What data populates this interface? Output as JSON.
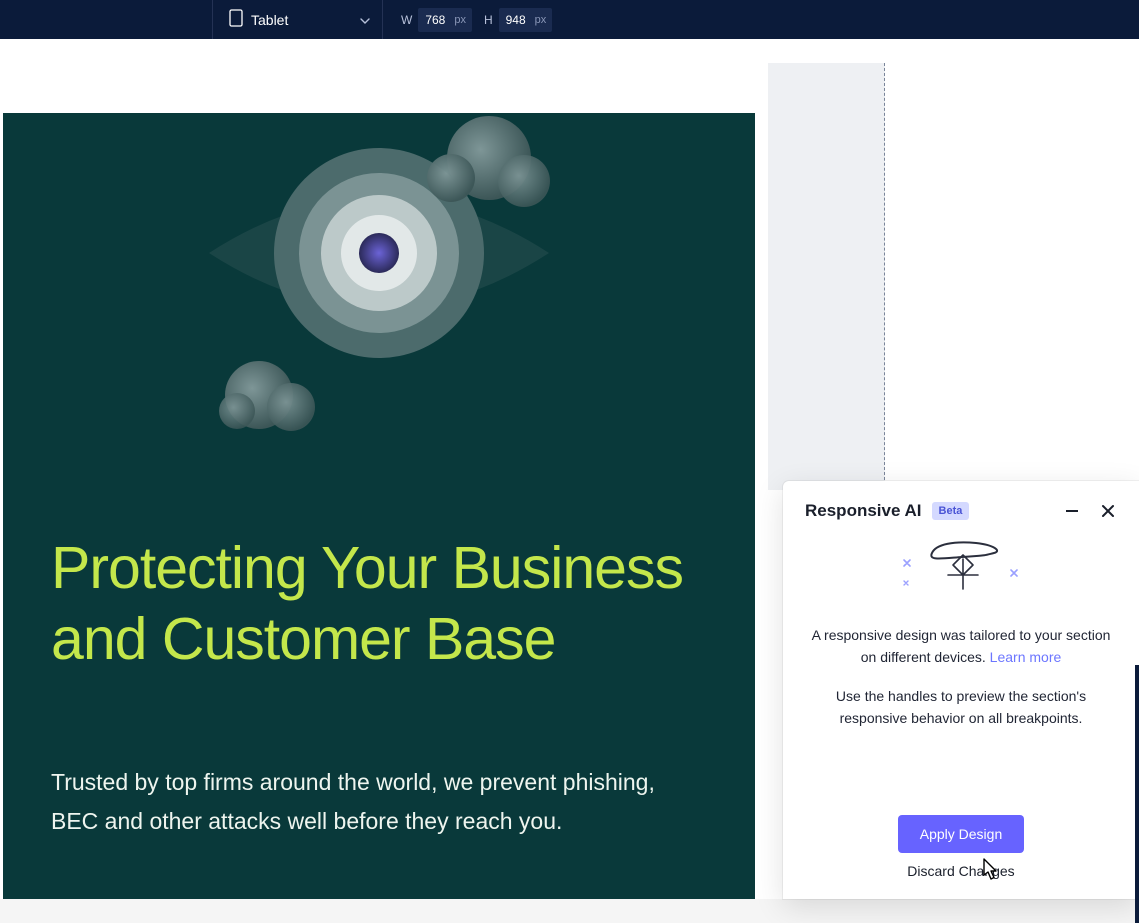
{
  "topbar": {
    "device_label": "Tablet",
    "w_label": "W",
    "w_value": "768",
    "w_unit": "px",
    "h_label": "H",
    "h_value": "948",
    "h_unit": "px"
  },
  "hero": {
    "title": "Protecting Your Business and Customer Base",
    "subtitle": "Trusted by top firms around the world, we prevent phishing, BEC and other attacks well before they reach you."
  },
  "panel": {
    "title": "Responsive AI",
    "badge": "Beta",
    "para1_a": "A responsive design was tailored to your section on different devices. ",
    "learn_more": "Learn more",
    "para2": "Use the handles to preview the section's responsive behavior on all breakpoints.",
    "apply": "Apply Design",
    "discard": "Discard Changes"
  },
  "colors": {
    "topbar_bg": "#0b1b3a",
    "hero_bg": "#09393a",
    "accent": "#c4e74b",
    "primary": "#6763ff",
    "link": "#6c76ff"
  }
}
